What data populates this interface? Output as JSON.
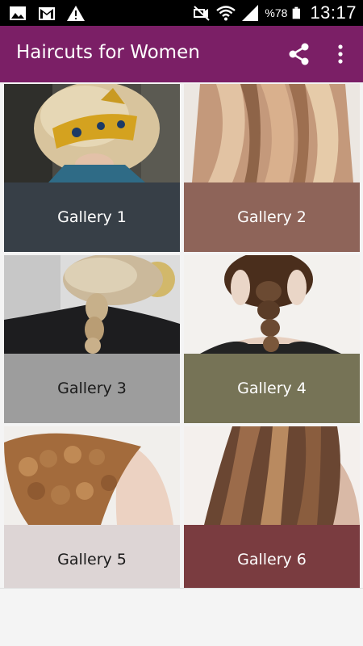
{
  "status_bar": {
    "icons_left": [
      "image-icon",
      "gmail-icon",
      "warning-icon"
    ],
    "icons_right": [
      "mute-icon",
      "wifi-icon",
      "signal-icon",
      "battery-icon"
    ],
    "battery_percent": "%78",
    "time": "13:17"
  },
  "app_bar": {
    "title": "Haircuts for Women",
    "background": "#7b1f66",
    "share_icon": "share-icon",
    "overflow_icon": "more-vert-icon"
  },
  "galleries": [
    {
      "label": "Gallery 1",
      "caption_color": "#373f47",
      "text_color": "#ffffff"
    },
    {
      "label": "Gallery 2",
      "caption_color": "#8e6459",
      "text_color": "#ffffff"
    },
    {
      "label": "Gallery 3",
      "caption_color": "#9d9d9d",
      "text_color": "#1a1a1a"
    },
    {
      "label": "Gallery 4",
      "caption_color": "#767356",
      "text_color": "#ffffff"
    },
    {
      "label": "Gallery 5",
      "caption_color": "#ddd5d5",
      "text_color": "#1a1a1a"
    },
    {
      "label": "Gallery 6",
      "caption_color": "#7a3c40",
      "text_color": "#ffffff"
    }
  ]
}
